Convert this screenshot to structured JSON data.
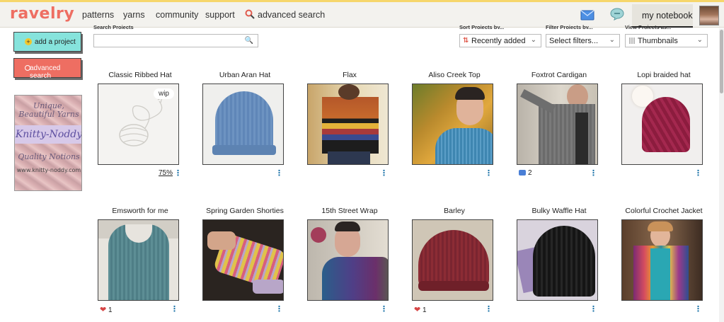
{
  "nav": {
    "logo": "ravelry",
    "links": [
      "patterns",
      "yarns",
      "community",
      "support"
    ],
    "advanced_search": "advanced search",
    "notebook": "my notebook"
  },
  "sidebar": {
    "add_project": "add a project",
    "advanced_search": "advanced search",
    "ad": {
      "line1": "Unique,",
      "line2": "Beautiful Yarns",
      "brand": "Knitty-Noddy",
      "line4": "Quality Notions",
      "url": "www.knitty-noddy.com"
    }
  },
  "filters": {
    "search_label": "Search Projects",
    "search_placeholder": "",
    "sort_label": "Sort Projects by...",
    "sort_value": "Recently added",
    "filter_label": "Filter Projects by...",
    "filter_value": "Select filters...",
    "view_label": "View Projects as...",
    "view_value": "Thumbnails"
  },
  "projects": [
    {
      "title": "Classic Ribbed Hat",
      "badge": "wip",
      "progress": "75%",
      "image": "placeholder"
    },
    {
      "title": "Urban Aran Hat",
      "image": "blue-hat"
    },
    {
      "title": "Flax",
      "image": "striped-sweater"
    },
    {
      "title": "Aliso Creek Top",
      "image": "woman-blue-top"
    },
    {
      "title": "Foxtrot Cardigan",
      "comments": "2",
      "image": "grey-cardigan"
    },
    {
      "title": "Lopi braided hat",
      "image": "burgundy-hat"
    },
    {
      "title": "Emsworth for me",
      "hearts": "1",
      "image": "teal-vest"
    },
    {
      "title": "Spring Garden Shorties",
      "image": "glove"
    },
    {
      "title": "15th Street Wrap",
      "image": "purple-wrap"
    },
    {
      "title": "Barley",
      "hearts": "1",
      "image": "red-hat"
    },
    {
      "title": "Bulky Waffle Hat",
      "image": "black-hat"
    },
    {
      "title": "Colorful Crochet Jacket",
      "image": "crochet-jacket"
    }
  ]
}
